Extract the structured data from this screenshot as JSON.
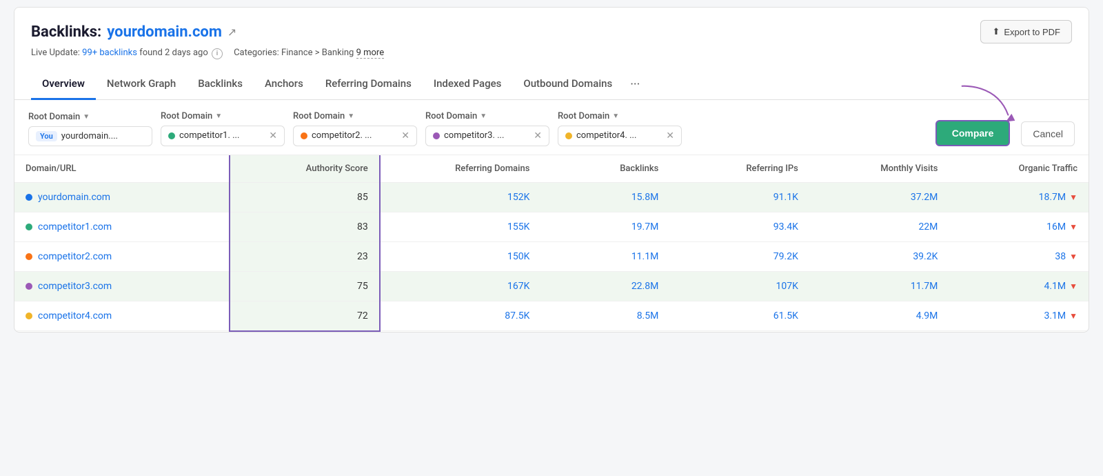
{
  "header": {
    "title_prefix": "Backlinks:",
    "title_domain": "yourdomain.com",
    "export_label": "Export to PDF",
    "subtitle_live": "Live Update:",
    "subtitle_links": "99+ backlinks",
    "subtitle_found": "found 2 days ago",
    "subtitle_categories": "Categories: Finance > Banking",
    "subtitle_more": "9 more"
  },
  "nav": {
    "tabs": [
      {
        "label": "Overview",
        "active": true
      },
      {
        "label": "Network Graph",
        "active": false
      },
      {
        "label": "Backlinks",
        "active": false
      },
      {
        "label": "Anchors",
        "active": false
      },
      {
        "label": "Referring Domains",
        "active": false
      },
      {
        "label": "Indexed Pages",
        "active": false
      },
      {
        "label": "Outbound Domains",
        "active": false
      }
    ],
    "more_label": "···"
  },
  "filters": {
    "groups": [
      {
        "label": "Root Domain",
        "you": true,
        "domain": "yourdomain....",
        "dot_color": "#1a73e8",
        "has_x": false
      },
      {
        "label": "Root Domain",
        "you": false,
        "domain": "competitor1. ...",
        "dot_color": "#2daa7a",
        "has_x": true
      },
      {
        "label": "Root Domain",
        "you": false,
        "domain": "competitor2. ...",
        "dot_color": "#f97316",
        "has_x": true
      },
      {
        "label": "Root Domain",
        "you": false,
        "domain": "competitor3. ...",
        "dot_color": "#9b59b6",
        "has_x": true
      },
      {
        "label": "Root Domain",
        "you": false,
        "domain": "competitor4. ...",
        "dot_color": "#f0b429",
        "has_x": true
      }
    ],
    "compare_label": "Compare",
    "cancel_label": "Cancel"
  },
  "table": {
    "columns": [
      {
        "key": "domain",
        "label": "Domain/URL",
        "align": "left"
      },
      {
        "key": "authority",
        "label": "Authority Score",
        "align": "right"
      },
      {
        "key": "referring_domains",
        "label": "Referring Domains",
        "align": "right"
      },
      {
        "key": "backlinks",
        "label": "Backlinks",
        "align": "right"
      },
      {
        "key": "referring_ips",
        "label": "Referring IPs",
        "align": "right"
      },
      {
        "key": "monthly_visits",
        "label": "Monthly Visits",
        "align": "right"
      },
      {
        "key": "organic_traffic",
        "label": "Organic Traffic",
        "align": "right"
      }
    ],
    "rows": [
      {
        "domain": "yourdomain.com",
        "dot_color": "#1a73e8",
        "authority": "85",
        "referring_domains": "152K",
        "backlinks": "15.8M",
        "referring_ips": "91.1K",
        "monthly_visits": "37.2M",
        "organic_traffic": "18.7M",
        "highlight": true
      },
      {
        "domain": "competitor1.com",
        "dot_color": "#2daa7a",
        "authority": "83",
        "referring_domains": "155K",
        "backlinks": "19.7M",
        "referring_ips": "93.4K",
        "monthly_visits": "22M",
        "organic_traffic": "16M",
        "highlight": false
      },
      {
        "domain": "competitor2.com",
        "dot_color": "#f97316",
        "authority": "23",
        "referring_domains": "150K",
        "backlinks": "11.1M",
        "referring_ips": "79.2K",
        "monthly_visits": "39.2K",
        "organic_traffic": "38",
        "highlight": false
      },
      {
        "domain": "competitor3.com",
        "dot_color": "#9b59b6",
        "authority": "75",
        "referring_domains": "167K",
        "backlinks": "22.8M",
        "referring_ips": "107K",
        "monthly_visits": "11.7M",
        "organic_traffic": "4.1M",
        "highlight": true
      },
      {
        "domain": "competitor4.com",
        "dot_color": "#f0b429",
        "authority": "72",
        "referring_domains": "87.5K",
        "backlinks": "8.5M",
        "referring_ips": "61.5K",
        "monthly_visits": "4.9M",
        "organic_traffic": "3.1M",
        "highlight": false
      }
    ]
  }
}
